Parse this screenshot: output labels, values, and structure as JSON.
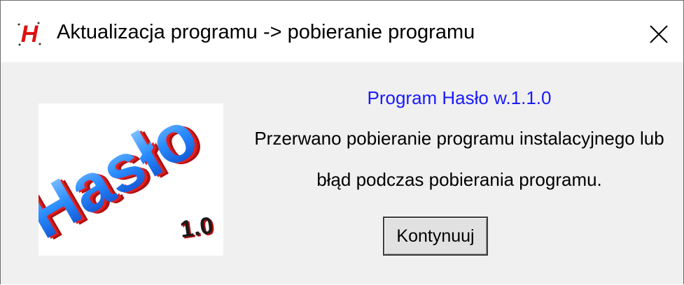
{
  "window": {
    "title": "Aktualizacja programu -> pobieranie programu",
    "app_icon": "h-logo-icon",
    "close_icon": "close-icon"
  },
  "dialog": {
    "program_version": "Program Hasło w.1.1.0",
    "message_line_1": "Przerwano pobieranie programu instalacyjnego lub",
    "message_line_2": "błąd podczas pobierania programu.",
    "continue_label": "Kontynuuj"
  },
  "logo": {
    "word": "Hasło",
    "version_badge": "1.0"
  },
  "colors": {
    "titlebar_bg": "#ffffff",
    "client_bg": "#f0f0f0",
    "version_text": "#1a1aff",
    "logo_red": "#e02020",
    "logo_blue": "#2a7fff"
  }
}
